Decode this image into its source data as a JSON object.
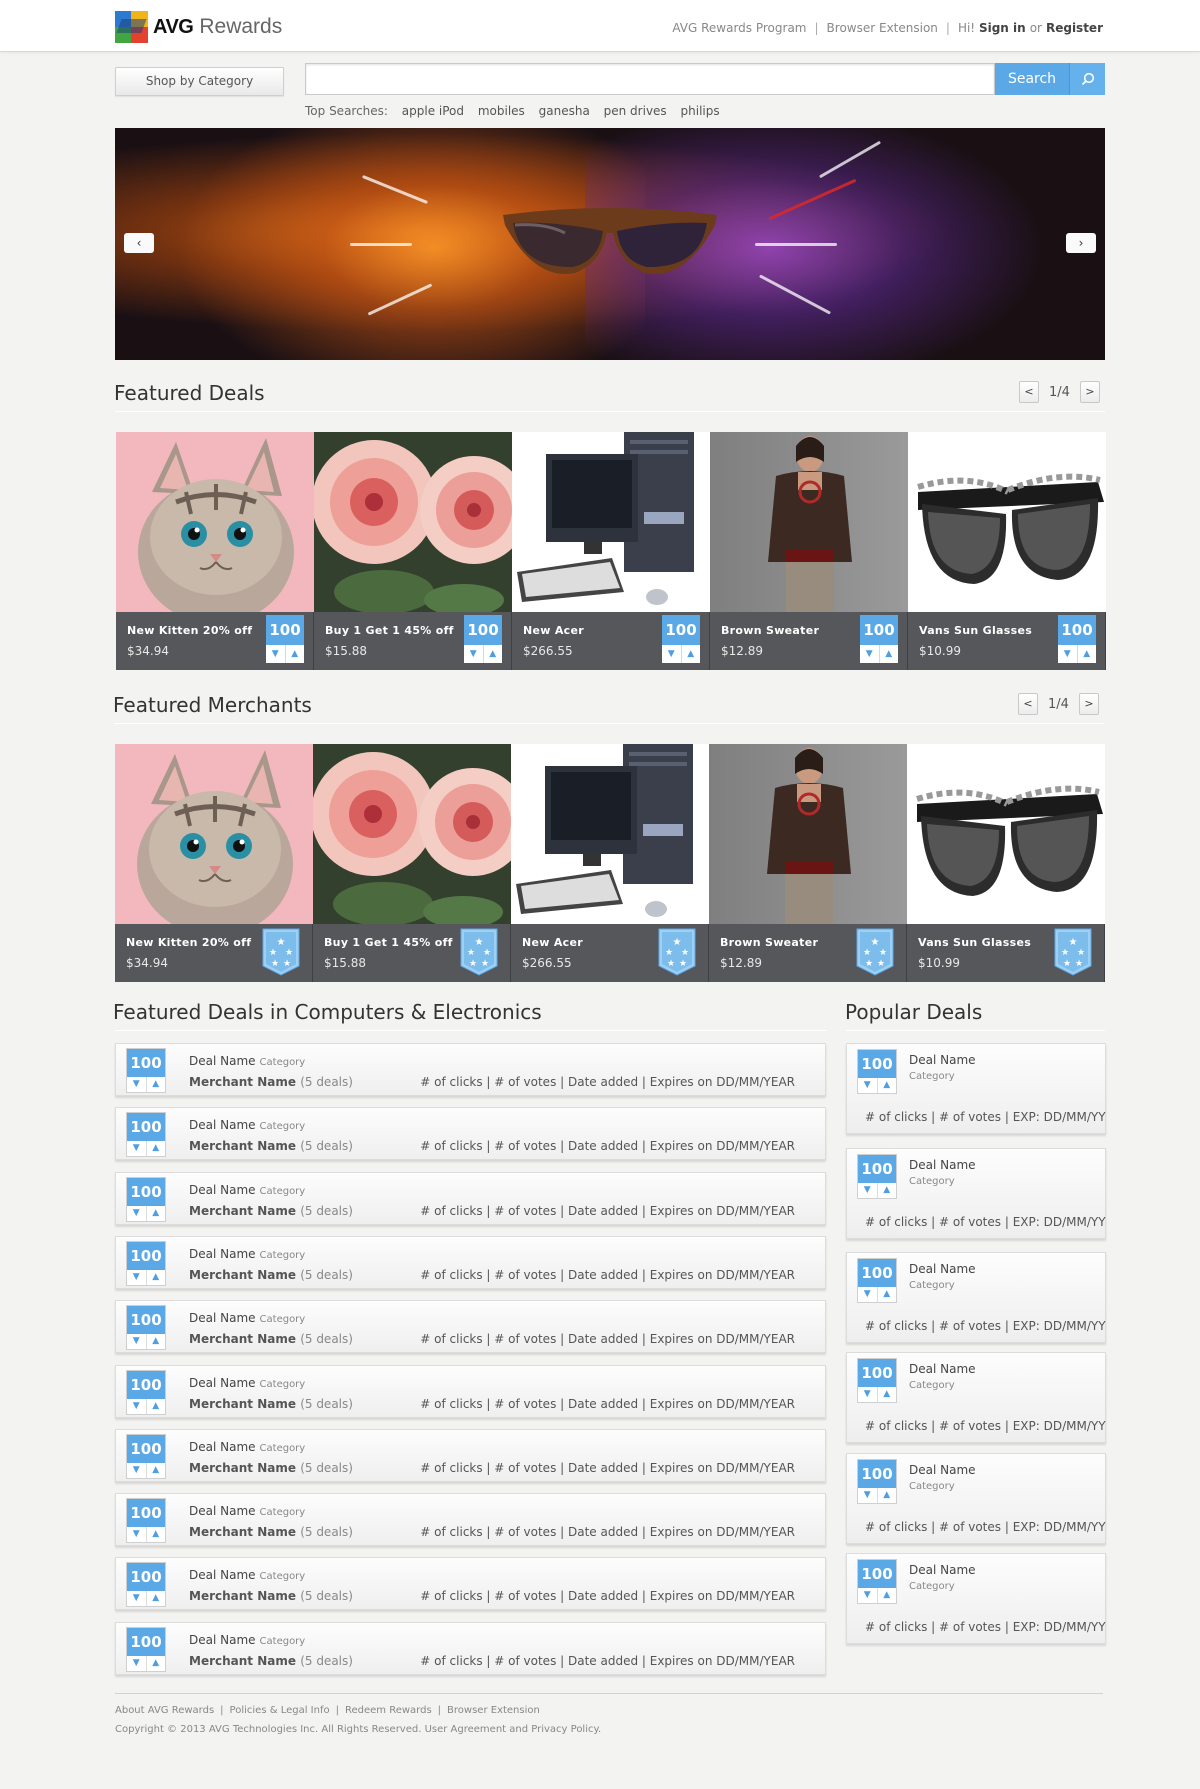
{
  "header": {
    "logo_brand": "AVG",
    "logo_product": "Rewards",
    "links": [
      "AVG Rewards Program",
      "Browser Extension"
    ],
    "greeting": "Hi!",
    "sign_in": "Sign in",
    "or": "or",
    "register": "Register"
  },
  "search": {
    "category_button": "Shop by Category",
    "input_value": "",
    "button": "Search",
    "top_searches_label": "Top Searches:",
    "top_searches": [
      "apple iPod",
      "mobiles",
      "ganesha",
      "pen drives",
      "philips"
    ]
  },
  "hero": {
    "prev": "‹",
    "next": "›"
  },
  "featured_deals": {
    "title": "Featured Deals",
    "page": "1/4",
    "items": [
      {
        "name": "New Kitten 20% off",
        "price": "$34.94",
        "votes": "100",
        "image": "kitten"
      },
      {
        "name": "Buy 1 Get 1 45% off",
        "price": "$15.88",
        "votes": "100",
        "image": "flowers"
      },
      {
        "name": "New Acer",
        "price": "$266.55",
        "votes": "100",
        "image": "computer"
      },
      {
        "name": "Brown Sweater",
        "price": "$12.89",
        "votes": "100",
        "image": "model"
      },
      {
        "name": "Vans Sun Glasses",
        "price": "$10.99",
        "votes": "100",
        "image": "sunglasses"
      }
    ]
  },
  "featured_merchants": {
    "title": "Featured Merchants",
    "page": "1/4",
    "items": [
      {
        "name": "New Kitten 20% off",
        "price": "$34.94",
        "image": "kitten"
      },
      {
        "name": "Buy 1 Get 1 45% off",
        "price": "$15.88",
        "image": "flowers"
      },
      {
        "name": "New Acer",
        "price": "$266.55",
        "image": "computer"
      },
      {
        "name": "Brown Sweater",
        "price": "$12.89",
        "image": "model"
      },
      {
        "name": "Vans Sun Glasses",
        "price": "$10.99",
        "image": "sunglasses"
      }
    ]
  },
  "category_deals": {
    "title": "Featured Deals in Computers & Electronics",
    "items": [
      {
        "votes": "100",
        "deal": "Deal Name",
        "category": "Category",
        "merchant": "Merchant Name",
        "merchant_count": "(5 deals)",
        "meta": "# of clicks | # of votes | Date added | Expires on DD/MM/YEAR"
      },
      {
        "votes": "100",
        "deal": "Deal Name",
        "category": "Category",
        "merchant": "Merchant Name",
        "merchant_count": "(5 deals)",
        "meta": "# of clicks | # of votes | Date added | Expires on DD/MM/YEAR"
      },
      {
        "votes": "100",
        "deal": "Deal Name",
        "category": "Category",
        "merchant": "Merchant Name",
        "merchant_count": "(5 deals)",
        "meta": "# of clicks | # of votes | Date added | Expires on DD/MM/YEAR"
      },
      {
        "votes": "100",
        "deal": "Deal Name",
        "category": "Category",
        "merchant": "Merchant Name",
        "merchant_count": "(5 deals)",
        "meta": "# of clicks | # of votes | Date added | Expires on DD/MM/YEAR"
      },
      {
        "votes": "100",
        "deal": "Deal Name",
        "category": "Category",
        "merchant": "Merchant Name",
        "merchant_count": "(5 deals)",
        "meta": "# of clicks | # of votes | Date added | Expires on DD/MM/YEAR"
      },
      {
        "votes": "100",
        "deal": "Deal Name",
        "category": "Category",
        "merchant": "Merchant Name",
        "merchant_count": "(5 deals)",
        "meta": "# of clicks | # of votes | Date added | Expires on DD/MM/YEAR"
      },
      {
        "votes": "100",
        "deal": "Deal Name",
        "category": "Category",
        "merchant": "Merchant Name",
        "merchant_count": "(5 deals)",
        "meta": "# of clicks | # of votes | Date added | Expires on DD/MM/YEAR"
      },
      {
        "votes": "100",
        "deal": "Deal Name",
        "category": "Category",
        "merchant": "Merchant Name",
        "merchant_count": "(5 deals)",
        "meta": "# of clicks | # of votes | Date added | Expires on DD/MM/YEAR"
      },
      {
        "votes": "100",
        "deal": "Deal Name",
        "category": "Category",
        "merchant": "Merchant Name",
        "merchant_count": "(5 deals)",
        "meta": "# of clicks | # of votes | Date added | Expires on DD/MM/YEAR"
      },
      {
        "votes": "100",
        "deal": "Deal Name",
        "category": "Category",
        "merchant": "Merchant Name",
        "merchant_count": "(5 deals)",
        "meta": "# of clicks | # of votes | Date added | Expires on DD/MM/YEAR"
      }
    ]
  },
  "popular_deals": {
    "title": "Popular Deals",
    "items": [
      {
        "votes": "100",
        "deal": "Deal Name",
        "category": "Category",
        "meta": "# of clicks | # of votes |  EXP: DD/MM/YY"
      },
      {
        "votes": "100",
        "deal": "Deal Name",
        "category": "Category",
        "meta": "# of clicks | # of votes |  EXP: DD/MM/YY"
      },
      {
        "votes": "100",
        "deal": "Deal Name",
        "category": "Category",
        "meta": "# of clicks | # of votes |  EXP: DD/MM/YY"
      },
      {
        "votes": "100",
        "deal": "Deal Name",
        "category": "Category",
        "meta": "# of clicks | # of votes |  EXP: DD/MM/YY"
      },
      {
        "votes": "100",
        "deal": "Deal Name",
        "category": "Category",
        "meta": "# of clicks | # of votes |  EXP: DD/MM/YY"
      },
      {
        "votes": "100",
        "deal": "Deal Name",
        "category": "Category",
        "meta": "# of clicks | # of votes |  EXP: DD/MM/YY"
      }
    ]
  },
  "footer": {
    "links": [
      "About AVG Rewards",
      "Policies & Legal Info",
      "Redeem Rewards",
      "Browser Extension"
    ],
    "copyright": "Copyright © 2013 AVG Technologies Inc. All Rights Reserved. User Agreement and Privacy Policy."
  },
  "colors": {
    "accent_blue": "#5aa9e6",
    "caption_gray": "#55575a",
    "page_bg": "#f3f3f1"
  },
  "icons": {
    "search": "magnifier-icon",
    "vote_down": "arrow-down-icon",
    "vote_up": "arrow-up-icon",
    "merchant_badge": "star-badge-icon"
  }
}
